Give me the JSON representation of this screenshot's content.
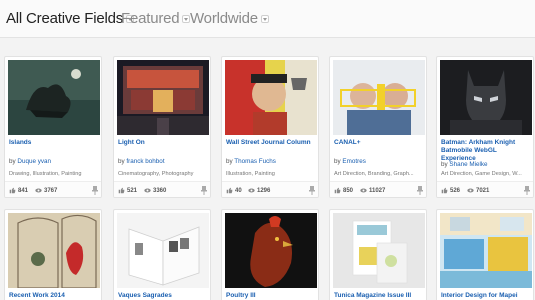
{
  "filters": {
    "field": "All Creative Fields",
    "sort": "Featured",
    "location": "Worldwide"
  },
  "projects": [
    {
      "title": "Islands",
      "by": "by",
      "author": "Duque yvan",
      "fields": "Drawing, Illustration, Painting",
      "likes": "841",
      "views": "3767"
    },
    {
      "title": "Light On",
      "by": "by",
      "author": "franck bohbot",
      "fields": "Cinematography, Photography",
      "likes": "521",
      "views": "3360"
    },
    {
      "title": "Wall Street Journal Column",
      "by": "by",
      "author": "Thomas Fuchs",
      "fields": "Illustration, Painting",
      "likes": "40",
      "views": "1296"
    },
    {
      "title": "CANAL+",
      "by": "by",
      "author": "Emotres",
      "fields": "Art Direction, Branding, Graph...",
      "likes": "850",
      "views": "11027"
    },
    {
      "title": "Batman: Arkham Knight Batmobile WebGL Experience",
      "by": "by",
      "author": "Shane Mielke",
      "fields": "Art Direction, Game Design, W...",
      "likes": "526",
      "views": "7021"
    },
    {
      "title": "Recent Work 2014"
    },
    {
      "title": "Vaques Sagrades"
    },
    {
      "title": "Poultry III"
    },
    {
      "title": "Tunica Magazine Issue III"
    },
    {
      "title": "Interior Design for Mapei"
    }
  ],
  "icons": {
    "like": "thumbs-up-icon",
    "views": "eye-icon",
    "save": "pin-icon"
  }
}
